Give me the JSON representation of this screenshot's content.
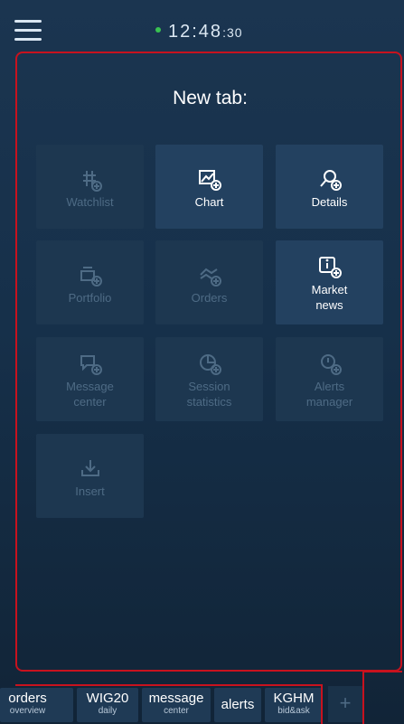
{
  "status": {
    "time_main": "12:48",
    "time_seconds": ":30",
    "connection_color": "#39c251"
  },
  "new_tab": {
    "title": "New tab:",
    "tiles": [
      {
        "line1": "Watchlist",
        "line2": "",
        "icon": "watchlist-icon",
        "enabled": false
      },
      {
        "line1": "Chart",
        "line2": "",
        "icon": "chart-icon",
        "enabled": true
      },
      {
        "line1": "Details",
        "line2": "",
        "icon": "details-icon",
        "enabled": true
      },
      {
        "line1": "Portfolio",
        "line2": "",
        "icon": "portfolio-icon",
        "enabled": false
      },
      {
        "line1": "Orders",
        "line2": "",
        "icon": "orders-icon",
        "enabled": false
      },
      {
        "line1": "Market",
        "line2": "news",
        "icon": "market-news-icon",
        "enabled": true
      },
      {
        "line1": "Message",
        "line2": "center",
        "icon": "message-center-icon",
        "enabled": false
      },
      {
        "line1": "Session",
        "line2": "statistics",
        "icon": "session-statistics-icon",
        "enabled": false
      },
      {
        "line1": "Alerts",
        "line2": "manager",
        "icon": "alerts-manager-icon",
        "enabled": false
      },
      {
        "line1": "Insert",
        "line2": "",
        "icon": "insert-icon",
        "enabled": false
      }
    ]
  },
  "bottom_tabs": [
    {
      "title": "orders",
      "subtitle": "overview"
    },
    {
      "title": "WIG20",
      "subtitle": "daily"
    },
    {
      "title": "message",
      "subtitle": "center"
    },
    {
      "title": "alerts",
      "subtitle": ""
    },
    {
      "title": "KGHM",
      "subtitle": "bid&ask"
    }
  ],
  "add_tab_label": "+",
  "colors": {
    "accent_red": "#c8121e",
    "tile_active": "#234160",
    "tile_inactive": "#1d3750"
  }
}
